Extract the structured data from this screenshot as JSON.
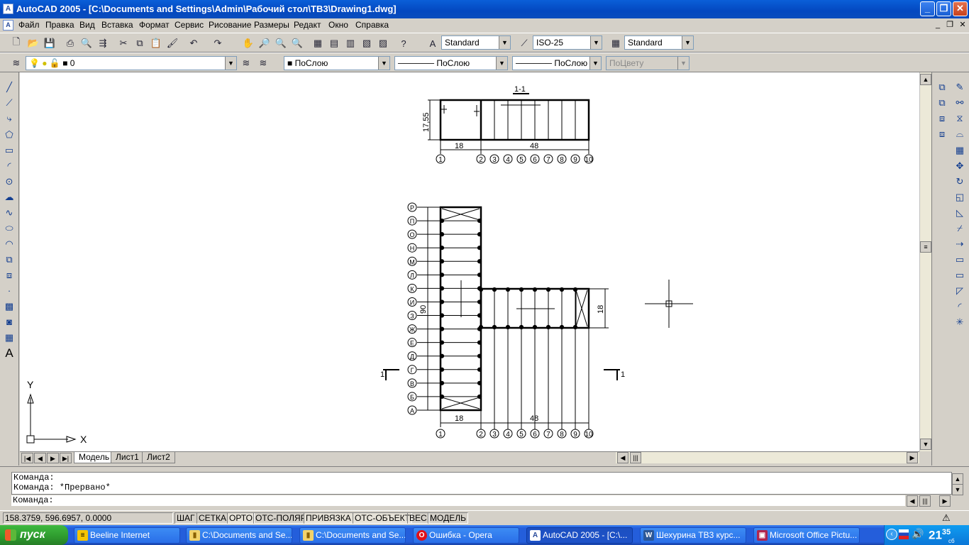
{
  "app": {
    "title": "AutoCAD 2005 - [C:\\Documents and Settings\\Admin\\Рабочий стол\\ТВ3\\Drawing1.dwg]",
    "icon": "autocad-app-icon",
    "window_buttons": {
      "minimize": "_",
      "restore": "❐",
      "close": "✕"
    }
  },
  "menu": {
    "items": [
      "Файл",
      "Правка",
      "Вид",
      "Вставка",
      "Формат",
      "Сервис",
      "Рисование",
      "Размеры",
      "Редакт",
      "Окно",
      "Справка"
    ],
    "mdi_buttons": {
      "minimize": "_",
      "restore": "❐",
      "close": "✕"
    }
  },
  "styles_toolbar": {
    "text_style": "Standard",
    "dim_style": "ISO-25",
    "table_style": "Standard"
  },
  "properties_toolbar": {
    "layer": "0",
    "color": "ПоСлою",
    "linetype": "ПоСлою",
    "lineweight": "ПоСлою",
    "plotstyle": "ПоЦвету"
  },
  "drawing": {
    "section_label": "1-1",
    "section_marker_left": "1",
    "section_marker_right": "1",
    "top_view": {
      "height_dim": "17,55",
      "dim_left": "18",
      "dim_right": "48",
      "axis_numbers": [
        "1",
        "2",
        "3",
        "4",
        "5",
        "6",
        "7",
        "8",
        "9",
        "10"
      ]
    },
    "plan_view": {
      "row_letters": [
        "Р",
        "П",
        "О",
        "Н",
        "М",
        "Л",
        "К",
        "И",
        "З",
        "Ж",
        "Е",
        "Д",
        "Г",
        "В",
        "Б",
        "А"
      ],
      "height_dim": "90",
      "right_dim": "18",
      "dim_left": "18",
      "dim_right": "48",
      "axis_numbers": [
        "1",
        "2",
        "3",
        "4",
        "5",
        "6",
        "7",
        "8",
        "9",
        "10"
      ]
    },
    "ucs": {
      "x_label": "X",
      "y_label": "Y"
    }
  },
  "layout_tabs": [
    "Модель",
    "Лист1",
    "Лист2"
  ],
  "command_line": {
    "history": [
      "Команда:",
      "Команда: *Прервано*"
    ],
    "prompt": "Команда:"
  },
  "status_bar": {
    "coordinates": "158.3759, 596.6957, 0.0000",
    "toggles": [
      "ШАГ",
      "СЕТКА",
      "ОРТО",
      "ОТС-ПОЛЯР",
      "ПРИВЯЗКА",
      "ОТС-ОБЪЕКТ",
      "ВЕС",
      "МОДЕЛЬ"
    ]
  },
  "taskbar": {
    "start_label": "пуск",
    "tasks": [
      {
        "label": "Beeline Internet",
        "icon": "beeline-icon"
      },
      {
        "label": "C:\\Documents and Se...",
        "icon": "folder-icon"
      },
      {
        "label": "C:\\Documents and Se...",
        "icon": "folder-icon"
      },
      {
        "label": "Ошибка - Opera",
        "icon": "opera-icon"
      },
      {
        "label": "AutoCAD 2005 - [C:\\...",
        "icon": "autocad-icon"
      },
      {
        "label": "Шехурина ТВ3 курс...",
        "icon": "word-icon"
      },
      {
        "label": "Microsoft Office Pictu...",
        "icon": "picture-manager-icon"
      }
    ],
    "clock": "21",
    "clock_minutes": "35",
    "clock_day": "сб"
  },
  "colors": {
    "title_bar": "#0a5fd8",
    "taskbar": "#245edb",
    "start_button": "#3fb93f",
    "canvas": "#ffffff"
  }
}
